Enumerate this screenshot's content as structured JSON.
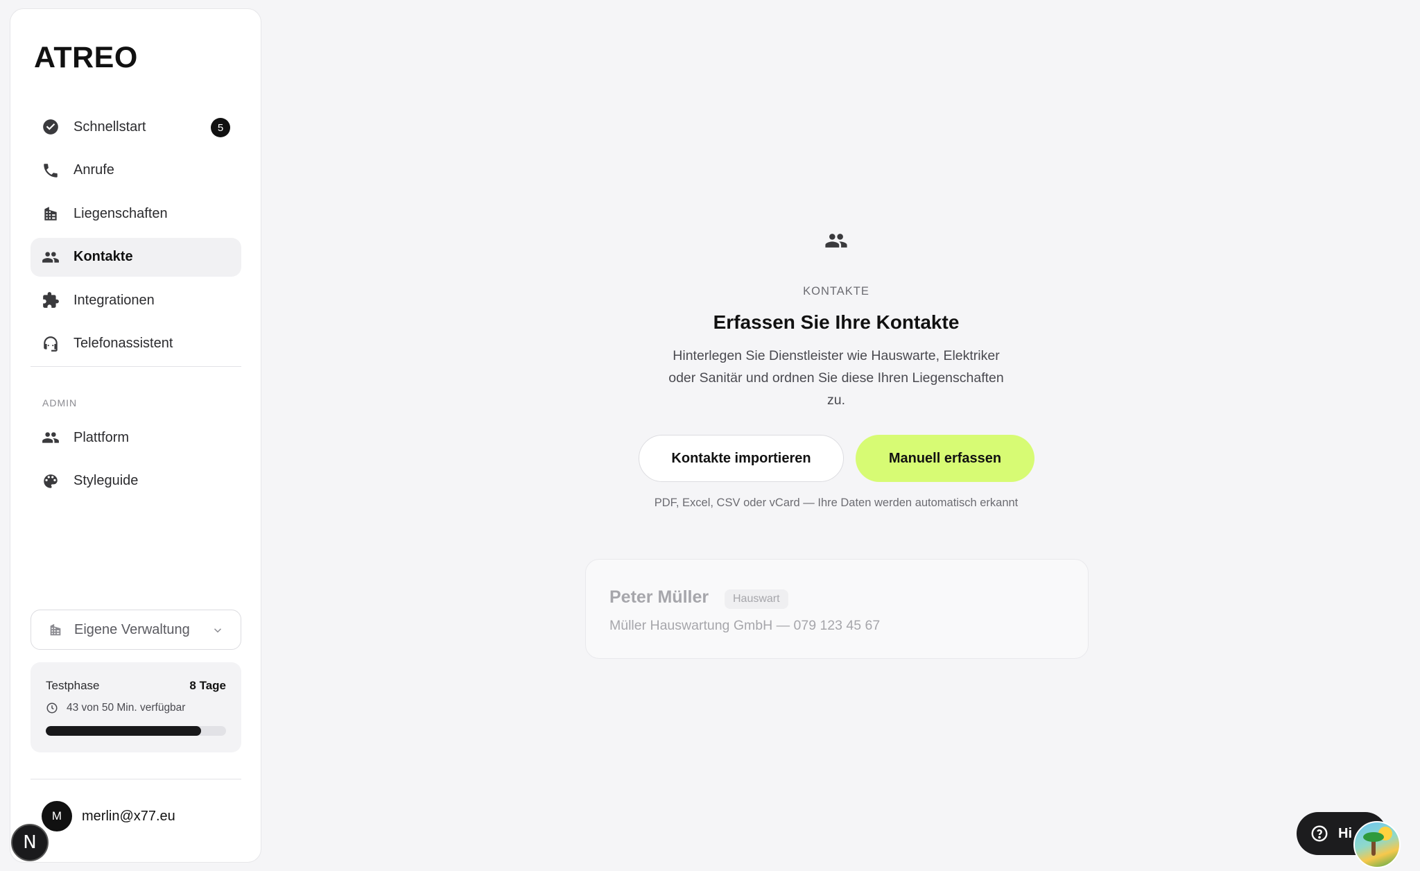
{
  "app": {
    "logo": "ATREO"
  },
  "sidebar": {
    "items": [
      {
        "label": "Schnellstart",
        "icon": "check-circle-icon",
        "badge": "5"
      },
      {
        "label": "Anrufe",
        "icon": "phone-icon"
      },
      {
        "label": "Liegenschaften",
        "icon": "building-icon"
      },
      {
        "label": "Kontakte",
        "icon": "people-icon",
        "active": true
      },
      {
        "label": "Integrationen",
        "icon": "puzzle-icon"
      },
      {
        "label": "Telefonassistent",
        "icon": "headset-icon"
      }
    ],
    "admin_label": "ADMIN",
    "admin_items": [
      {
        "label": "Plattform",
        "icon": "people-icon"
      },
      {
        "label": "Styleguide",
        "icon": "palette-icon"
      }
    ],
    "org_select": {
      "value": "Eigene Verwaltung"
    },
    "trial": {
      "label": "Testphase",
      "days": "8 Tage",
      "usage": "43 von 50 Min. verfügbar",
      "used_fraction": 0.86
    },
    "user": {
      "initial": "M",
      "email": "merlin@x77.eu"
    },
    "dev_badge": "N"
  },
  "main": {
    "kicker": "KONTAKTE",
    "headline": "Erfassen Sie Ihre Kontakte",
    "description": "Hinterlegen Sie Dienstleister wie Hauswarte, Elektriker oder Sanitär und ordnen Sie diese Ihren Liegenschaften zu.",
    "import_button": "Kontakte importieren",
    "manual_button": "Manuell erfassen",
    "hint": "PDF, Excel, CSV oder vCard — Ihre Daten werden automatisch erkannt",
    "example_card": {
      "name": "Peter Müller",
      "tag": "Hauswart",
      "company": "Müller Hauswartung GmbH",
      "phone": " — 079 123 45 67"
    }
  },
  "help": {
    "label": "Hi"
  },
  "colors": {
    "accent": "#d7fb74",
    "dark": "#111111"
  }
}
